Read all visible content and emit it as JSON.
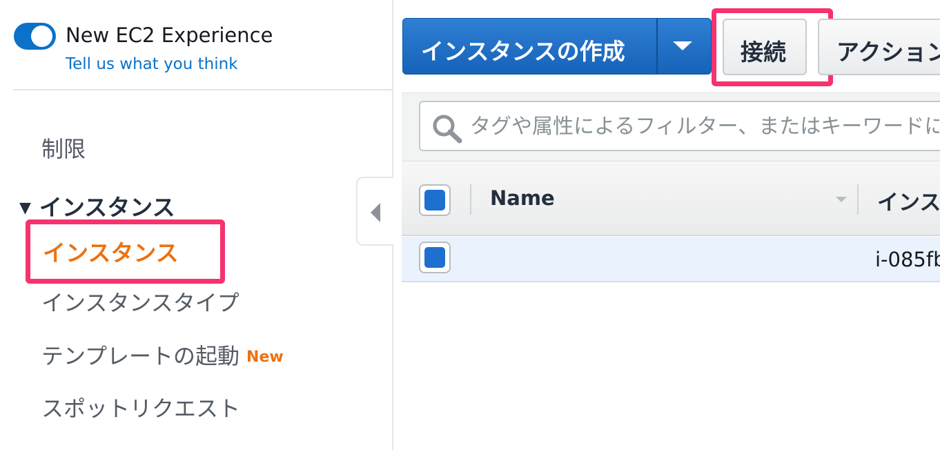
{
  "experience": {
    "toggle_on": true,
    "title": "New EC2 Experience",
    "feedback_link": "Tell us what you think"
  },
  "sidebar": {
    "limits": "制限",
    "section_title": "インスタンス",
    "section_expanded_icon": "triangle-down",
    "items": [
      {
        "label": "インスタンス",
        "active": true
      },
      {
        "label": "インスタンスタイプ"
      },
      {
        "label": "テンプレートの起動",
        "badge": "New"
      },
      {
        "label": "スポットリクエスト"
      }
    ]
  },
  "toolbar": {
    "launch_label": "インスタンスの作成",
    "connect_label": "接続",
    "actions_label": "アクション"
  },
  "search": {
    "placeholder": "タグや属性によるフィルター、またはキーワードによる検索"
  },
  "table": {
    "columns": [
      "Name",
      "インスタンス ID"
    ],
    "rows": [
      {
        "name": "",
        "instance_id": "i-085fb"
      }
    ]
  },
  "colors": {
    "accent": "#0a72c9",
    "primary_button": "#1f6fd0",
    "active_nav": "#ec7211",
    "highlight": "#f7326f",
    "selected_row": "#eaf3fd"
  }
}
